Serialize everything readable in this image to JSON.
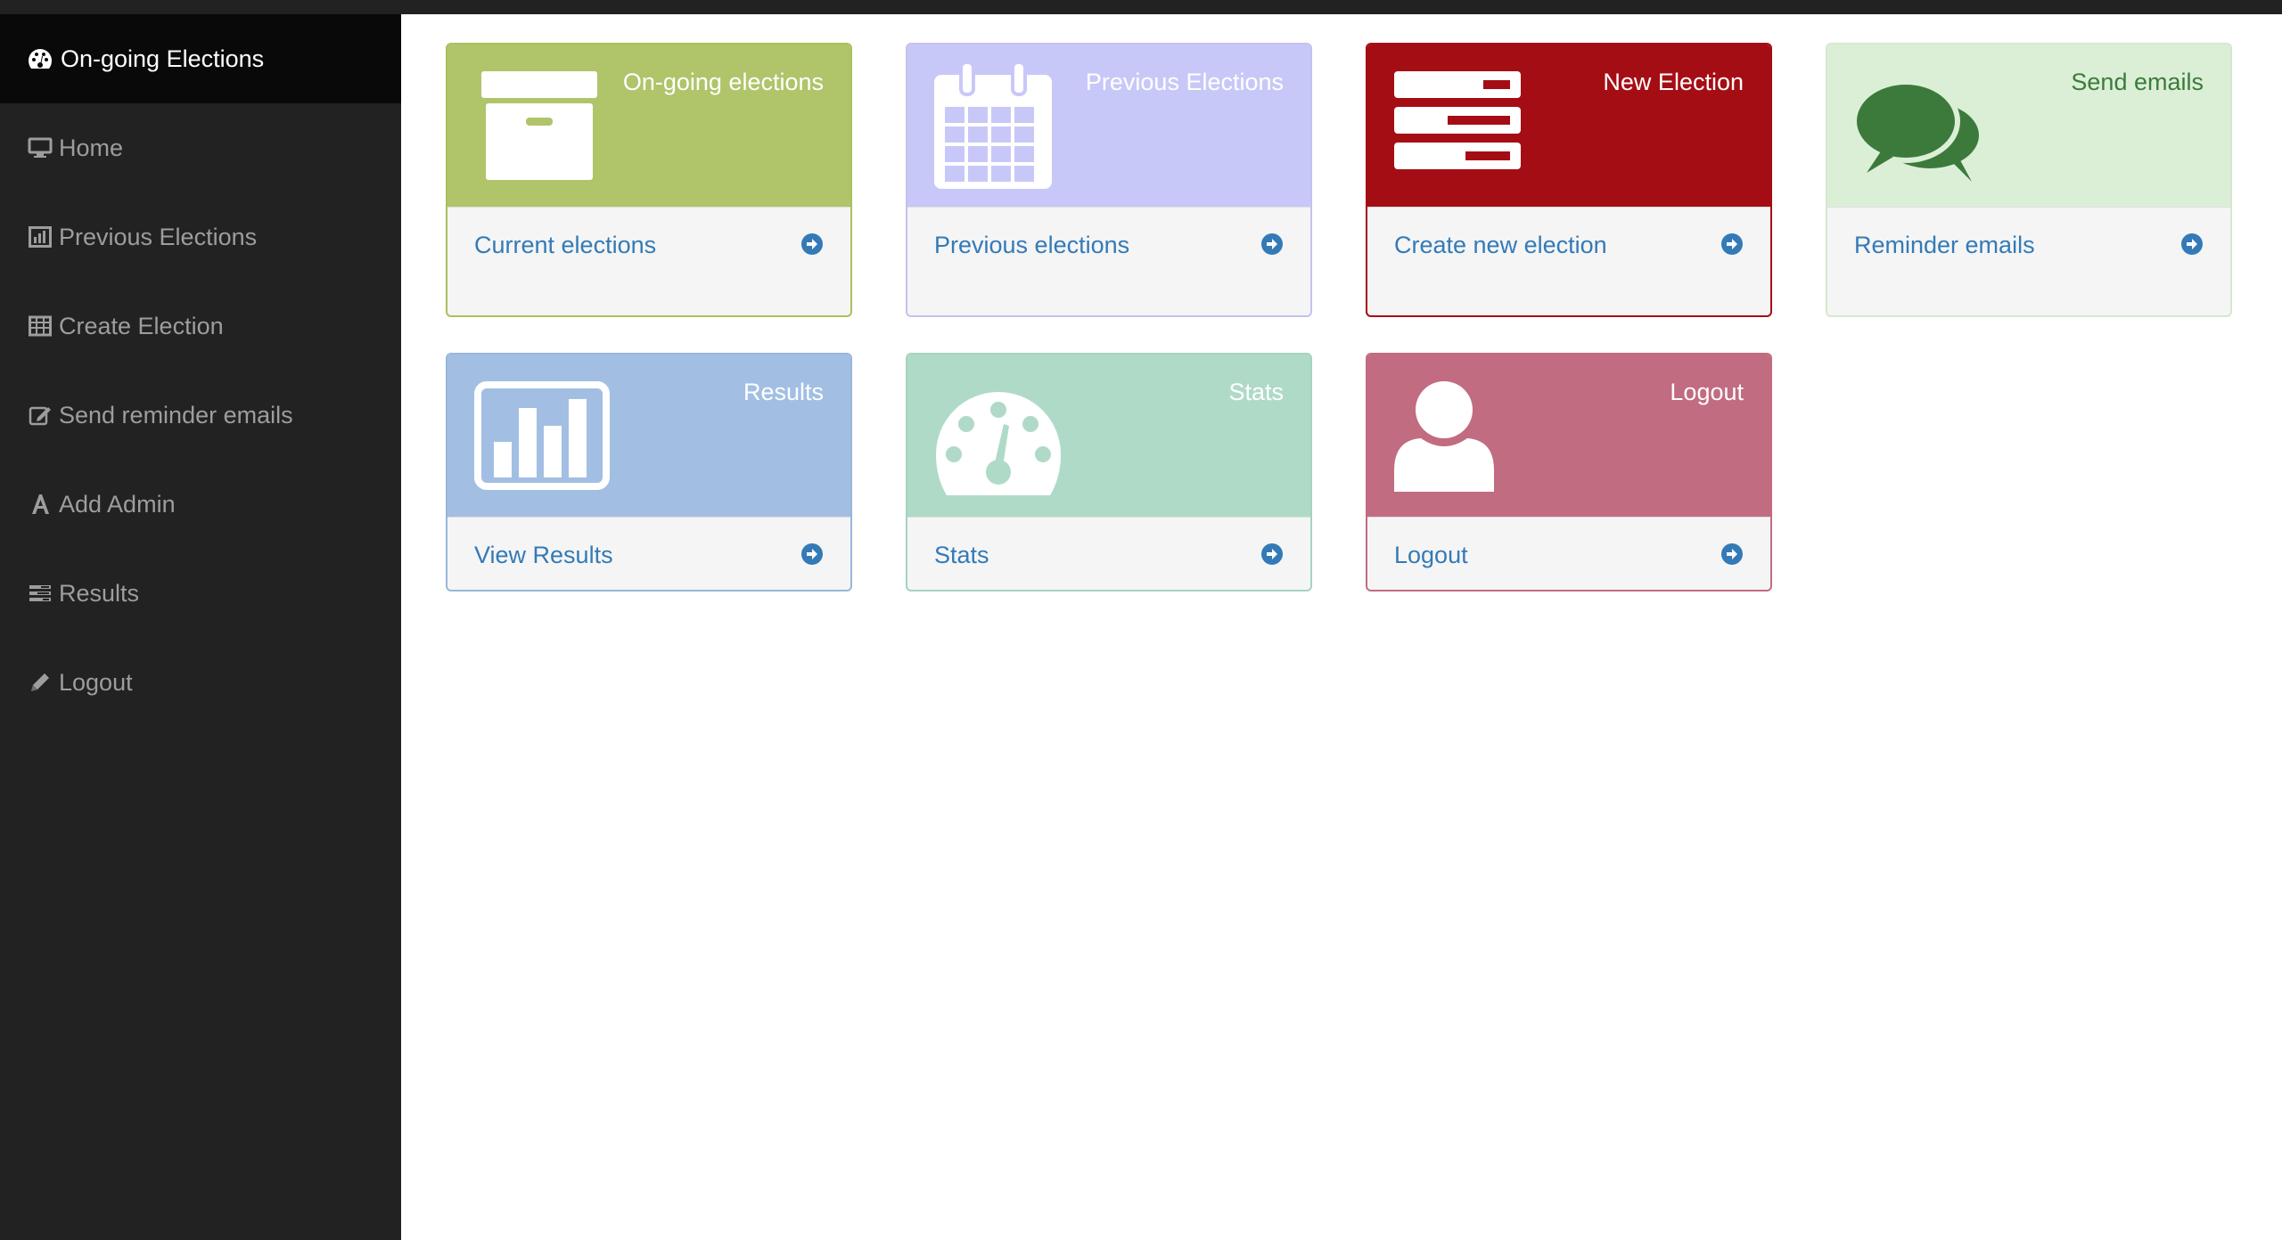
{
  "sidebar": {
    "header": "On-going Elections",
    "items": [
      {
        "label": "Home",
        "icon": "monitor-icon"
      },
      {
        "label": "Previous Elections",
        "icon": "bar-chart-icon"
      },
      {
        "label": "Create Election",
        "icon": "table-icon"
      },
      {
        "label": "Send reminder emails",
        "icon": "edit-icon"
      },
      {
        "label": "Add Admin",
        "icon": "font-icon"
      },
      {
        "label": "Results",
        "icon": "list-icon"
      },
      {
        "label": "Logout",
        "icon": "pencil-icon"
      }
    ]
  },
  "tiles": [
    {
      "title": "On-going elections",
      "link": "Current elections",
      "icon": "archive-icon",
      "head_color": "#b0c46a",
      "border_color": "#a9c05e",
      "title_color": "#ffffff"
    },
    {
      "title": "Previous Elections",
      "link": "Previous elections",
      "icon": "calendar-icon",
      "head_color": "#c8c8f8",
      "border_color": "#c2c2f0",
      "title_color": "#ffffff"
    },
    {
      "title": "New Election",
      "link": "Create new election",
      "icon": "tasks-icon",
      "head_color": "#a50d14",
      "border_color": "#a50d14",
      "title_color": "#ffffff"
    },
    {
      "title": "Send emails",
      "link": "Reminder emails",
      "icon": "comments-icon",
      "head_color": "#dbefd6",
      "border_color": "#d3e9cc",
      "title_color": "#3c7a3c"
    },
    {
      "title": "Results",
      "link": "View Results",
      "icon": "chart-icon",
      "head_color": "#a2bfe3",
      "border_color": "#98b6dd",
      "title_color": "#ffffff"
    },
    {
      "title": "Stats",
      "link": "Stats",
      "icon": "dashboard-icon",
      "head_color": "#b0dac8",
      "border_color": "#a6d3bf",
      "title_color": "#ffffff"
    },
    {
      "title": "Logout",
      "link": "Logout",
      "icon": "user-icon",
      "head_color": "#c16c80",
      "border_color": "#c16c80",
      "title_color": "#ffffff"
    }
  ],
  "colors": {
    "sidebar_bg": "#222222",
    "sidebar_header_bg": "#090909",
    "link": "#337ab7"
  }
}
